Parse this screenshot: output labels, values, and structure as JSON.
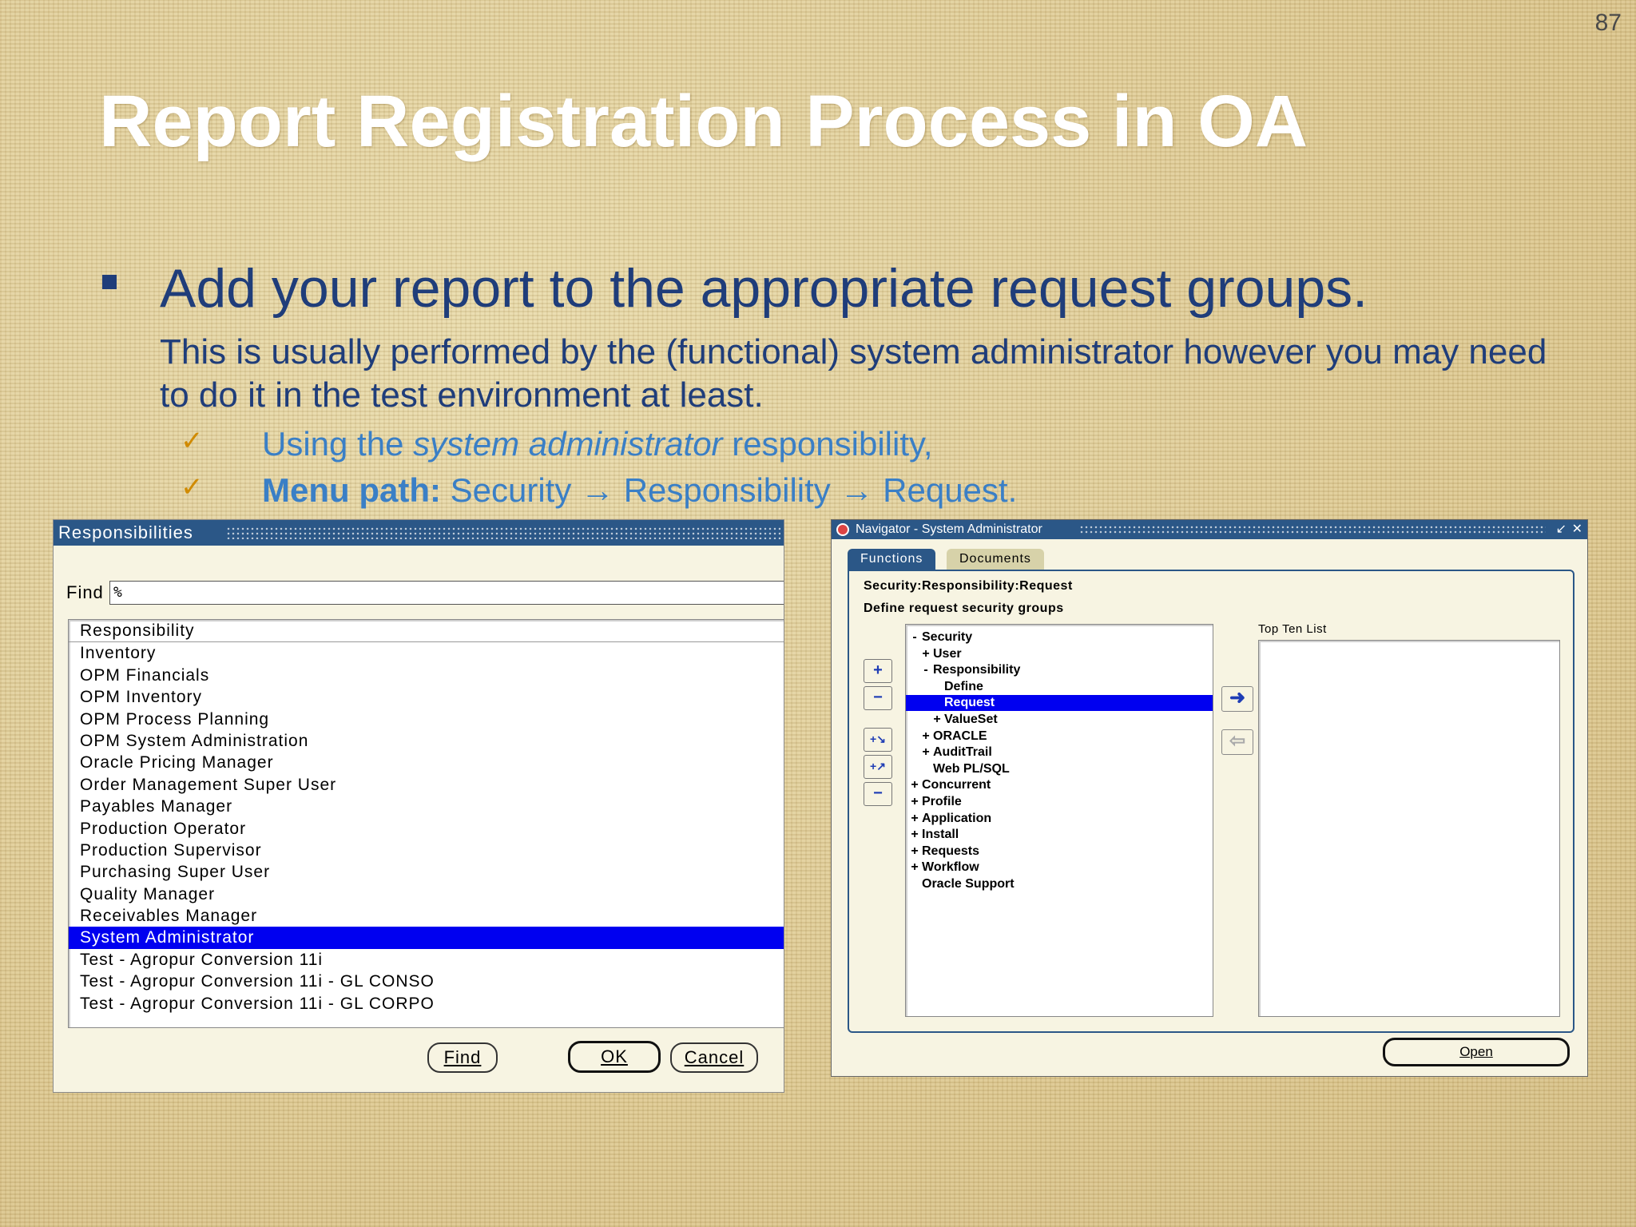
{
  "slide": {
    "number": "87",
    "title": "Report Registration Process in OA",
    "bullet": "Add your report to the appropriate request groups.",
    "subtext": "This is usually performed by the (functional) system administrator however you may need to do it in the test environment at least.",
    "check_mark": "✓",
    "item1_pre": "Using the ",
    "item1_italic": "system administrator",
    "item1_post": " responsibility,",
    "item2_bold": "Menu path:",
    "item2_rest": " Security → Responsibility → Request."
  },
  "responsibilities_window": {
    "title": "Responsibilities",
    "find_label": "Find",
    "find_value": "%",
    "column_header": "Responsibility",
    "rows": [
      "Inventory",
      "OPM Financials",
      "OPM Inventory",
      "OPM Process Planning",
      "OPM System Administration",
      "Oracle Pricing Manager",
      "Order Management Super User",
      "Payables Manager",
      "Production Operator",
      "Production Supervisor",
      "Purchasing Super User",
      "Quality Manager",
      "Receivables Manager",
      "System Administrator",
      "Test - Agropur Conversion 11i",
      "Test - Agropur Conversion 11i -  GL CONSO",
      "Test - Agropur Conversion 11i -  GL CORPO"
    ],
    "selected_row": "System Administrator",
    "buttons": {
      "find": "Find",
      "ok": "OK",
      "cancel": "Cancel"
    }
  },
  "navigator_window": {
    "title": "Navigator - System Administrator",
    "controls": {
      "minimize": "↙",
      "close": "✕"
    },
    "tabs": {
      "functions": "Functions",
      "documents": "Documents"
    },
    "path": "Security:Responsibility:Request",
    "description": "Define request security groups",
    "top_ten_label": "Top Ten List",
    "tree": [
      {
        "pm": "-",
        "label": "Security",
        "level": 0
      },
      {
        "pm": "+",
        "label": "User",
        "level": 1
      },
      {
        "pm": "-",
        "label": "Responsibility",
        "level": 1
      },
      {
        "pm": "",
        "label": "Define",
        "level": 2
      },
      {
        "pm": "",
        "label": "Request",
        "level": 2,
        "selected": true
      },
      {
        "pm": "+",
        "label": "ValueSet",
        "level": 2
      },
      {
        "pm": "+",
        "label": "ORACLE",
        "level": 1
      },
      {
        "pm": "+",
        "label": "AuditTrail",
        "level": 1
      },
      {
        "pm": "",
        "label": "Web PL/SQL",
        "level": 1
      },
      {
        "pm": "+",
        "label": "Concurrent",
        "level": 0
      },
      {
        "pm": "+",
        "label": "Profile",
        "level": 0
      },
      {
        "pm": "+",
        "label": "Application",
        "level": 0
      },
      {
        "pm": "+",
        "label": "Install",
        "level": 0
      },
      {
        "pm": "+",
        "label": "Requests",
        "level": 0
      },
      {
        "pm": "+",
        "label": "Workflow",
        "level": 0
      },
      {
        "pm": "",
        "label": "Oracle Support",
        "level": 0
      }
    ],
    "tools": {
      "expand": "+",
      "collapse": "−",
      "expand_branch": "+↘",
      "expand_all": "+↗",
      "collapse_all": "−"
    },
    "arrows": {
      "add": "➜",
      "remove": "⇦"
    },
    "open_button": "Open",
    "colors": {
      "selection": "#0000f0",
      "titlebar": "#2b5787"
    }
  }
}
